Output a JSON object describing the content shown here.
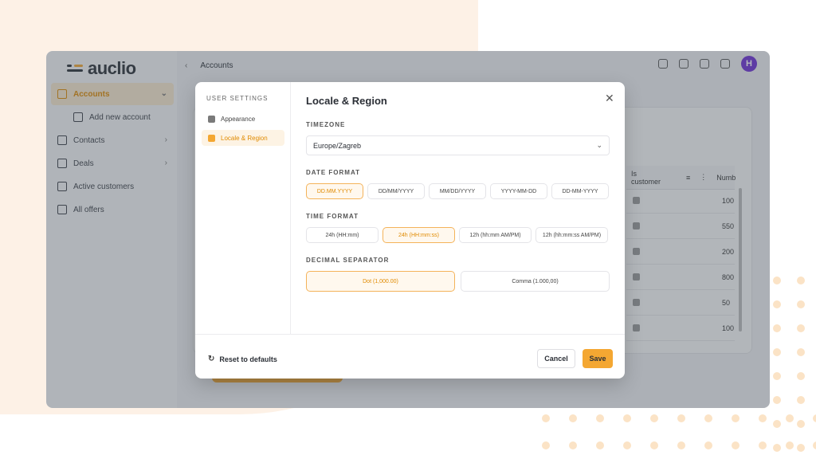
{
  "brand": {
    "name": "auclio",
    "accent": "#f4a732",
    "avatar_color": "#6e2fd6"
  },
  "sidebar": {
    "items": [
      {
        "label": "Accounts",
        "icon": "folder-icon",
        "active": true,
        "has_chevron": true
      },
      {
        "label": "Add new account",
        "icon": "add-window-icon",
        "sub": true
      },
      {
        "label": "Contacts",
        "icon": "people-icon",
        "has_chevron": true
      },
      {
        "label": "Deals",
        "icon": "dollar-icon",
        "has_chevron": true
      },
      {
        "label": "Active customers",
        "icon": "cart-icon"
      },
      {
        "label": "All offers",
        "icon": "document-plus-icon"
      }
    ]
  },
  "header": {
    "breadcrumb": "Accounts",
    "avatar_initial": "H"
  },
  "table": {
    "columns": [
      "Is customer",
      "Numb"
    ],
    "rows": [
      {
        "is_customer": true,
        "value": "100"
      },
      {
        "is_customer": false,
        "value": "550"
      },
      {
        "is_customer": true,
        "value": "200"
      },
      {
        "is_customer": false,
        "value": "800"
      },
      {
        "is_customer": false,
        "value": "50"
      },
      {
        "is_customer": false,
        "value": "100"
      }
    ]
  },
  "modal": {
    "side_title": "USER SETTINGS",
    "side_items": [
      {
        "label": "Appearance",
        "icon": "palette-icon",
        "active": false
      },
      {
        "label": "Locale & Region",
        "icon": "globe-icon",
        "active": true
      }
    ],
    "title": "Locale & Region",
    "timezone": {
      "label": "TIMEZONE",
      "value": "Europe/Zagreb"
    },
    "date_format": {
      "label": "DATE FORMAT",
      "options": [
        "DD.MM.YYYY",
        "DD/MM/YYYY",
        "MM/DD/YYYY",
        "YYYY-MM-DD",
        "DD-MM-YYYY"
      ],
      "selected": "DD.MM.YYYY"
    },
    "time_format": {
      "label": "TIME FORMAT",
      "options": [
        "24h (HH:mm)",
        "24h (HH:mm:ss)",
        "12h (hh:mm AM/PM)",
        "12h (hh:mm:ss AM/PM)"
      ],
      "selected": "24h (HH:mm:ss)"
    },
    "decimal_separator": {
      "label": "DECIMAL SEPARATOR",
      "options": [
        "Dot (1,000.00)",
        "Comma (1.000,00)"
      ],
      "selected": "Dot (1,000.00)"
    },
    "footer": {
      "reset": "Reset to defaults",
      "cancel": "Cancel",
      "save": "Save"
    }
  }
}
